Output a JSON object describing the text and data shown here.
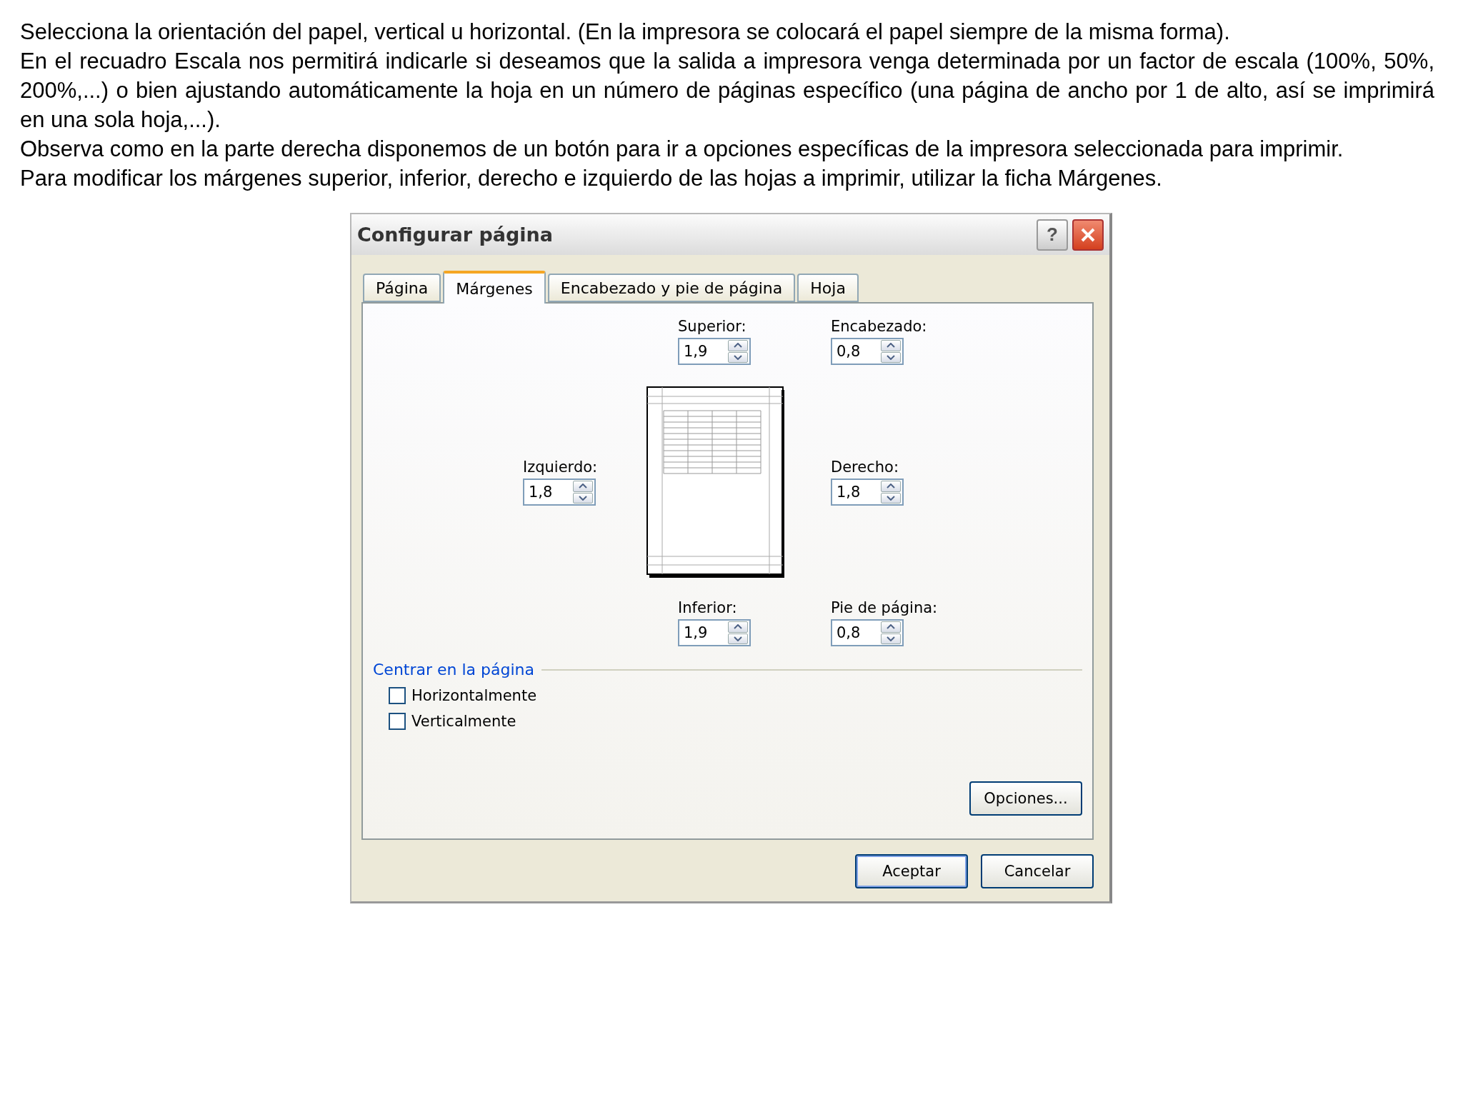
{
  "paragraphs": [
    "Selecciona la orientación del papel, vertical u horizontal. (En la impresora se colocará el papel siempre de la misma forma).",
    "En el recuadro Escala nos permitirá indicarle si deseamos que la salida a impresora venga determinada por un factor de escala (100%, 50%, 200%,...) o bien ajustando automáticamente la hoja en un número de páginas específico (una página de ancho por 1 de alto, así se imprimirá en una sola hoja,...).",
    "Observa como en la parte derecha disponemos de un botón para ir a opciones específicas de la impresora seleccionada para imprimir.",
    "Para modificar los márgenes superior, inferior, derecho e izquierdo de las hojas a imprimir, utilizar la ficha Márgenes."
  ],
  "dialog": {
    "title": "Configurar página",
    "help": "?",
    "tabs": [
      {
        "label": "Página",
        "selected": false
      },
      {
        "label": "Márgenes",
        "selected": true
      },
      {
        "label": "Encabezado y pie de página",
        "selected": false
      },
      {
        "label": "Hoja",
        "selected": false
      }
    ],
    "fields": [
      {
        "label": "Superior:",
        "value": "1,9"
      },
      {
        "label": "Encabezado:",
        "value": "0,8"
      },
      {
        "label": "Izquierdo:",
        "value": "1,8"
      },
      {
        "label": "Derecho:",
        "value": "1,8"
      },
      {
        "label": "Inferior:",
        "value": "1,9"
      },
      {
        "label": "Pie de página:",
        "value": "0,8"
      }
    ],
    "center_group": {
      "title": "Centrar en la página",
      "options": [
        {
          "label": "Horizontalmente",
          "checked": false
        },
        {
          "label": "Verticalmente",
          "checked": false
        }
      ]
    },
    "options_button": "Opciones...",
    "buttons": [
      "Aceptar",
      "Cancelar"
    ]
  }
}
